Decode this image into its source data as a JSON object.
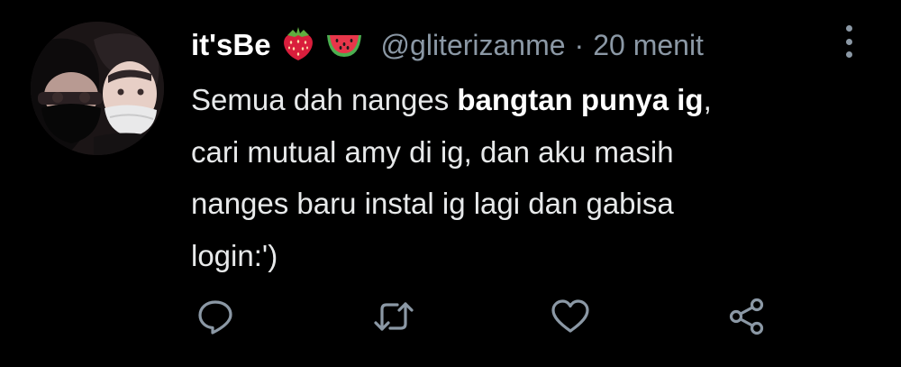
{
  "tweet": {
    "display_name": "it'sBe",
    "emojis": [
      "strawberry-emoji",
      "watermelon-emoji"
    ],
    "handle": "@gliterizanme",
    "separator": "·",
    "time": "20 menit",
    "body": {
      "line1_pre": "Semua dah nanges ",
      "line1_bold": "bangtan punya ig",
      "line1_post": ",",
      "line2": "cari mutual amy di ig, dan aku masih",
      "line3": "nanges baru instal ig lagi dan gabisa",
      "line4": "login:')"
    },
    "actions": [
      "reply-icon",
      "retweet-icon",
      "like-icon",
      "share-icon"
    ]
  },
  "colors": {
    "background": "#000000",
    "text": "#e7e9ea",
    "secondary": "#8b98a5",
    "strawberry": "#d91e3c",
    "watermelon_rind": "#4caf50",
    "watermelon_flesh": "#e8364a"
  }
}
